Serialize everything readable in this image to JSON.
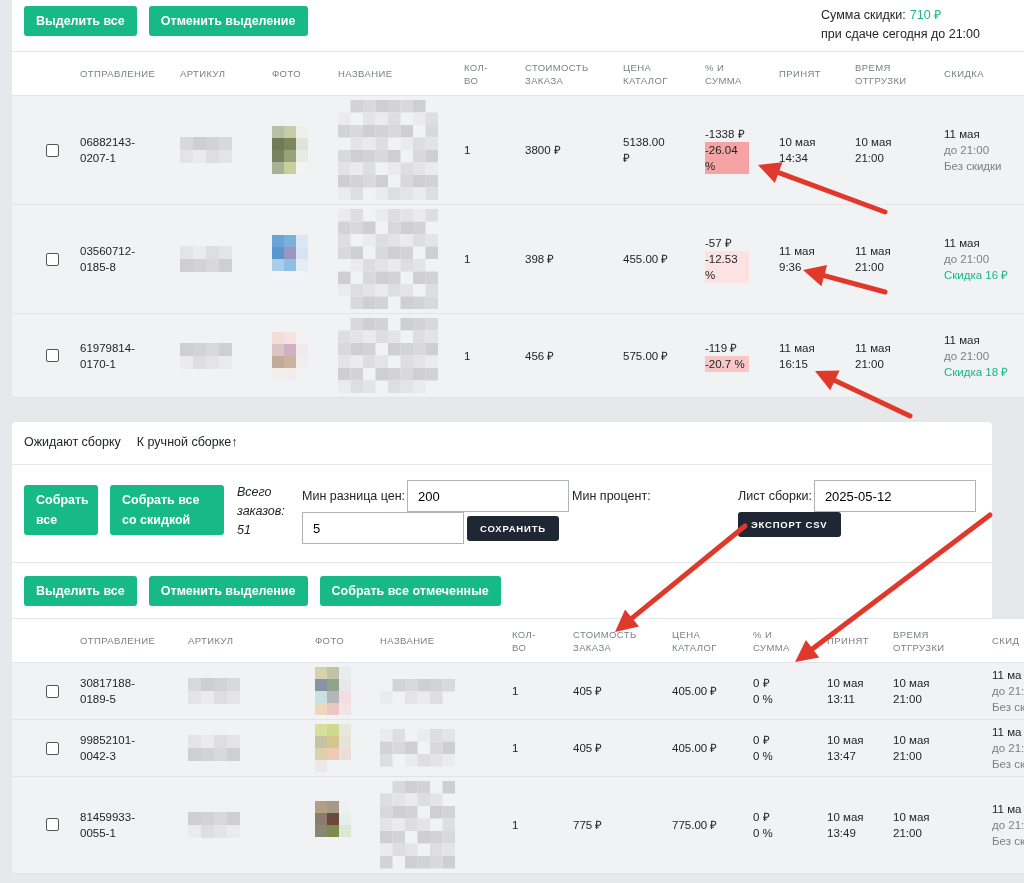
{
  "summary": {
    "label": "Сумма скидки:",
    "value": "710 ₽",
    "note": "при сдаче сегодня до 21:00"
  },
  "top_buttons": [
    "Выделить все",
    "Отменить выделение"
  ],
  "orders_table": {
    "columns": [
      "ОТПРАВЛЕНИЕ",
      "АРТИКУЛ",
      "ФОТО",
      "НАЗВАНИЕ",
      "КОЛ-\nВО",
      "СТОИМОСТЬ\nЗАКАЗА",
      "ЦЕНА\nКАТАЛОГ",
      "% И\nСУММА",
      "ПРИНЯТ",
      "ВРЕМЯ\nОТГРУЗКИ",
      "СКИДКА"
    ],
    "rows": [
      {
        "checked": false,
        "shipment": "06882143-0207-1",
        "qty": "1",
        "order_cost": "3800 ₽",
        "catalog_price": "5138.00 ₽",
        "diff_amount": "-1338 ₽",
        "diff_percent": "-26.04 %",
        "color": "#f5a3a3",
        "accepted": "10 мая 14:34",
        "ship_time": "10 мая 21:00",
        "discount": {
          "date": "11 мая",
          "deadline": "до 21:00",
          "text": "Без скидки",
          "applied": false
        }
      },
      {
        "checked": false,
        "shipment": "03560712-0185-8",
        "qty": "1",
        "order_cost": "398 ₽",
        "catalog_price": "455.00 ₽",
        "diff_amount": "-57 ₽",
        "diff_percent": "-12.53 %",
        "color": "#fde2e2",
        "accepted": "11 мая 9:36",
        "ship_time": "11 мая 21:00",
        "discount": {
          "date": "11 мая",
          "deadline": "до 21:00",
          "text": "Скидка 16 ₽",
          "applied": true
        }
      },
      {
        "checked": false,
        "shipment": "61979814-0170-1",
        "qty": "1",
        "order_cost": "456 ₽",
        "catalog_price": "575.00 ₽",
        "diff_amount": "-119 ₽",
        "diff_percent": "-20.7 %",
        "color": "#f8c6c6",
        "accepted": "11 мая 16:15",
        "ship_time": "11 мая 21:00",
        "discount": {
          "date": "11 мая",
          "deadline": "до 21:00",
          "text": "Скидка 18 ₽",
          "applied": true
        }
      }
    ]
  },
  "tabs": [
    {
      "label": "Ожидают сборку",
      "selected": false
    },
    {
      "label": "К ручной сборке↑",
      "selected": false
    }
  ],
  "controls": {
    "collect_buttons": [
      "Собрать все",
      "Собрать все со скидкой"
    ],
    "total": "Всего заказов: 51",
    "min_diff_label": "Мин разница цен:",
    "min_diff_value": "200",
    "min_percent_label": "Мин процент:",
    "min_percent_value": "5",
    "save_button": "СОХРАНИТЬ",
    "sheet_label": "Лист сборки:",
    "sheet_value": "2025-05-12",
    "export_button": "ЭКСПОРТ CSV"
  },
  "action_buttons": [
    "Выделить все",
    "Отменить выделение",
    "Собрать все отмеченные"
  ],
  "assembly_table": {
    "columns": [
      "ОТПРАВЛЕНИЕ",
      "АРТИКУЛ",
      "ФОТО",
      "НАЗВАНИЕ",
      "КОЛ-\nВО",
      "СТОИМОСТЬ\nЗАКАЗА",
      "ЦЕНА\nКАТАЛОГ",
      "% И\nСУММА",
      "ПРИНЯТ",
      "ВРЕМЯ\nОТГРУЗКИ",
      "СКИД"
    ],
    "rows": [
      {
        "checked": false,
        "shipment": "30817188-0189-5",
        "qty": "1",
        "order_cost": "405 ₽",
        "catalog_price": "405.00 ₽",
        "diff_amount": "0 ₽",
        "diff_percent": "0 %",
        "accepted": "10 мая 13:11",
        "ship_time": "10 мая 21:00",
        "discount": {
          "date": "11 ма",
          "deadline": "до 21:",
          "text": "Без ск",
          "applied": false
        }
      },
      {
        "checked": false,
        "shipment": "99852101-0042-3",
        "qty": "1",
        "order_cost": "405 ₽",
        "catalog_price": "405.00 ₽",
        "diff_amount": "0 ₽",
        "diff_percent": "0 %",
        "accepted": "10 мая 13:47",
        "ship_time": "10 мая 21:00",
        "discount": {
          "date": "11 ма",
          "deadline": "до 21:",
          "text": "Без ск",
          "applied": false
        }
      },
      {
        "checked": false,
        "shipment": "81459933-0055-1",
        "qty": "1",
        "order_cost": "775 ₽",
        "catalog_price": "775.00 ₽",
        "diff_amount": "0 ₽",
        "diff_percent": "0 %",
        "accepted": "10 мая 13:49",
        "ship_time": "10 мая 21:00",
        "discount": {
          "date": "11 ма",
          "deadline": "до 21:",
          "text": "Без ск",
          "applied": false
        }
      }
    ]
  },
  "annotation_arrows": [
    {
      "kind": "arrow"
    },
    {
      "kind": "arrow"
    },
    {
      "kind": "arrow"
    },
    {
      "kind": "arrow"
    },
    {
      "kind": "arrow"
    }
  ]
}
